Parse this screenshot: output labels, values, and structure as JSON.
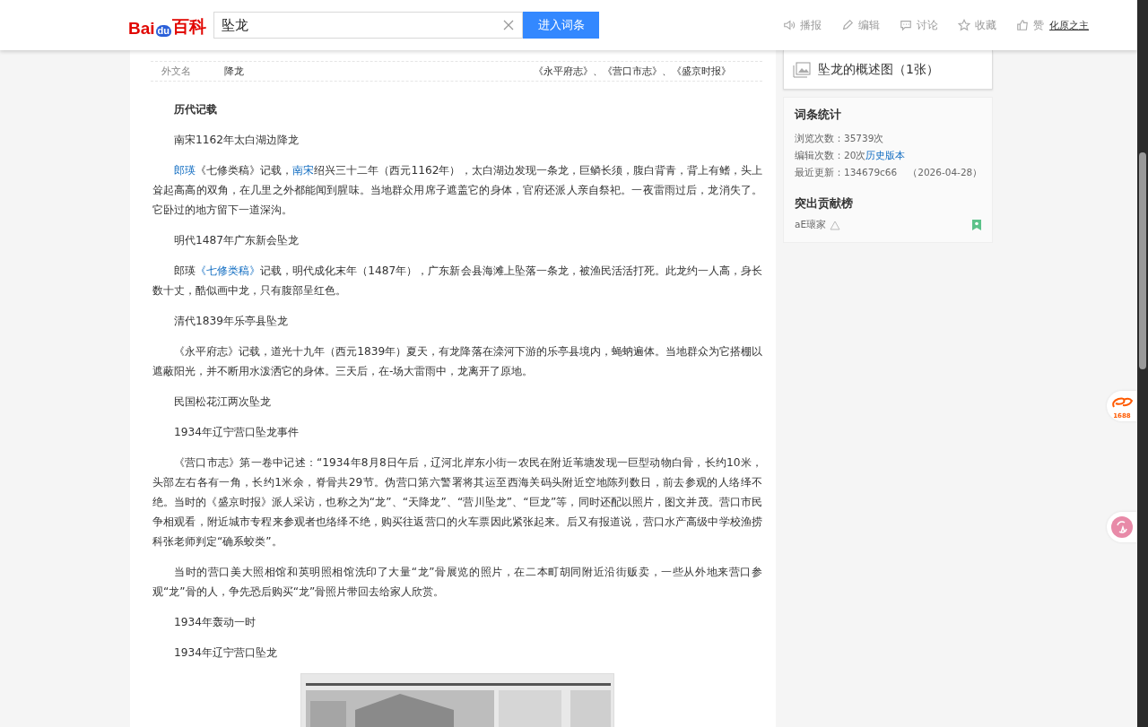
{
  "header": {
    "logo": {
      "left": "Bai",
      "badge": "du",
      "right": "百科"
    },
    "search": {
      "value": "坠龙"
    },
    "search_button": "进入词条",
    "actions": [
      {
        "kind": "speaker",
        "label": "播报"
      },
      {
        "kind": "pencil",
        "label": "编辑"
      },
      {
        "kind": "chat",
        "label": "讨论"
      },
      {
        "kind": "star",
        "label": "收藏"
      },
      {
        "kind": "thumb",
        "label": "赞"
      }
    ],
    "user_link": "化原之主"
  },
  "info_table": {
    "rows": [
      {
        "label": "外文名",
        "value": "降龙",
        "column_3": "《永平府志》、《营口市志》、《盛京时报》"
      }
    ]
  },
  "article": [
    {
      "kind": "heading",
      "text": "历代记载"
    },
    {
      "kind": "subheading",
      "text": "南宋1162年太白湖边降龙"
    },
    {
      "kind": "paragraph",
      "segments": [
        {
          "text": "郎瑛",
          "link": true
        },
        {
          "text": "《七修类稿》记载，",
          "link": false
        },
        {
          "text": "南宋",
          "link": true
        },
        {
          "text": "绍兴三十二年（西元1162年），太白湖边发现一条龙，巨鳞长须，腹白背青，背上有鳍，头上耸起高高的双角，在几里之外都能闻到腥味。当地群众用席子遮盖它的身体，官府还派人亲自祭祀。一夜雷雨过后，龙消失了。它卧过的地方留下一道深沟。",
          "link": false
        }
      ]
    },
    {
      "kind": "subheading",
      "text": "明代1487年广东新会坠龙"
    },
    {
      "kind": "paragraph",
      "segments": [
        {
          "text": "郎瑛",
          "link": false
        },
        {
          "text": "《七修类稿》",
          "link": true
        },
        {
          "text": "记载，明代成化末年（1487年），广东新会县海滩上坠落一条龙，被渔民活活打死。此龙约一人高，身长数十丈，酷似画中龙，只有腹部呈红色。",
          "link": false
        }
      ]
    },
    {
      "kind": "subheading",
      "text": "清代1839年乐亭县坠龙"
    },
    {
      "kind": "paragraph",
      "segments": [
        {
          "text": "《永平府志》记载，道光十九年（西元1839年）夏天，有龙降落在滦河下游的乐亭县境内，蝇蚋遍体。当地群众为它搭棚以遮蔽阳光，并不断用水泼洒它的身体。三天后，在-场大雷雨中，龙离开了原地。",
          "link": false
        }
      ]
    },
    {
      "kind": "subheading",
      "text": "民国松花江两次坠龙"
    },
    {
      "kind": "subheading",
      "text": "1934年辽宁营口坠龙事件"
    },
    {
      "kind": "paragraph",
      "segments": [
        {
          "text": "《营口市志》第一卷中记述：“1934年8月8日午后，辽河北岸东小街一农民在附近苇塘发现一巨型动物白骨，长约10米，头部左右各有一角，长约1米余，脊骨共29节。伪营口第六警署将其运至西海关码头附近空地陈列数日，前去参观的人络绎不绝。当时的《盛京时报》派人采访，也称之为“龙”、“天降龙”、“营川坠龙”、“巨龙”等，同时还配以照片，图文并茂。营口市民争相观看，附近城市专程来参观者也络绎不绝，购买往返营口的火车票因此紧张起来。后又有报道说，营口水产高级中学校渔捞科张老师判定“确系蛟类”。",
          "link": false
        }
      ]
    },
    {
      "kind": "paragraph",
      "segments": [
        {
          "text": "当时的营口美大照相馆和英明照相馆洗印了大量“龙”骨展览的照片，在二本町胡同附近沿街贩卖，一些从外地来营口参观“龙”骨的人，争先恐后购买“龙”骨照片带回去给家人欣赏。",
          "link": false
        }
      ]
    },
    {
      "kind": "subheading",
      "text": "1934年轰动一时"
    },
    {
      "kind": "subheading",
      "text": "1934年辽宁营口坠龙"
    },
    {
      "kind": "picture"
    }
  ],
  "sidebar": {
    "album": {
      "caption": "坠龙的概述图（1张）"
    },
    "stats": {
      "title": "词条统计",
      "rows": [
        {
          "kind": "plain",
          "label": "浏览次数：",
          "value": "35739次"
        },
        {
          "kind": "link",
          "label": "编辑次数：",
          "value": "20次",
          "link": "历史版本"
        },
        {
          "kind": "editor",
          "label": "最近更新：",
          "value": "134679c66",
          "date": "（2026-04-28）"
        }
      ]
    },
    "contributors": {
      "title": "突出贡献榜",
      "items": [
        {
          "name": "aE瓌家"
        }
      ]
    }
  },
  "floating": {
    "badge": "1688"
  }
}
